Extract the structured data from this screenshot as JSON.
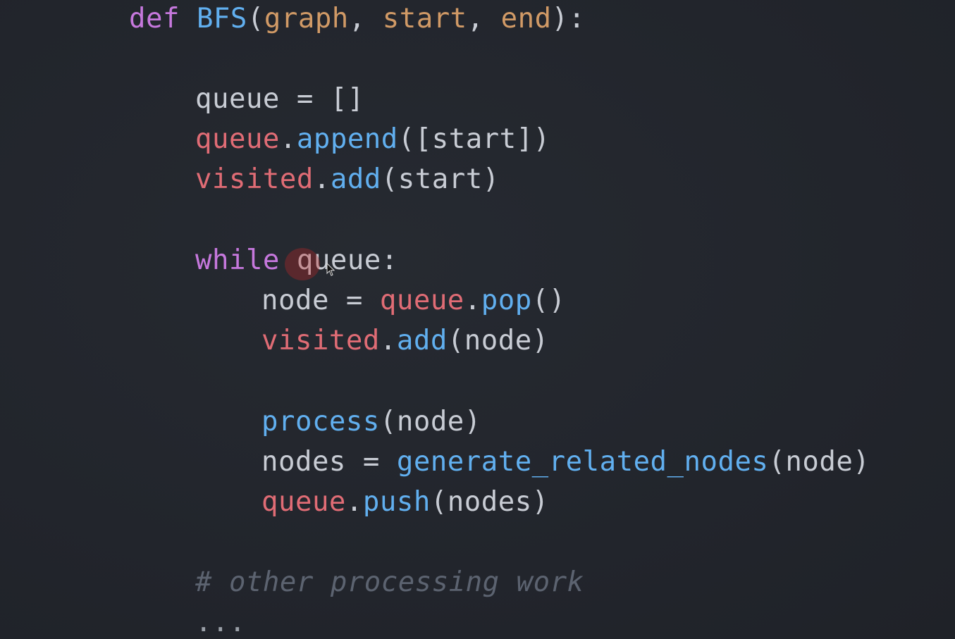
{
  "code": {
    "lines": [
      {
        "indent": 0,
        "tokens": [
          {
            "t": "def",
            "c": "kw"
          },
          {
            "t": " ",
            "c": "plain"
          },
          {
            "t": "BFS",
            "c": "fn"
          },
          {
            "t": "(",
            "c": "plain"
          },
          {
            "t": "graph",
            "c": "param"
          },
          {
            "t": ", ",
            "c": "plain"
          },
          {
            "t": "start",
            "c": "param"
          },
          {
            "t": ", ",
            "c": "plain"
          },
          {
            "t": "end",
            "c": "param"
          },
          {
            "t": "):",
            "c": "plain"
          }
        ]
      },
      {
        "indent": 1,
        "tokens": [
          {
            "t": "queue = []",
            "c": "plain"
          }
        ]
      },
      {
        "indent": 1,
        "tokens": [
          {
            "t": "queue",
            "c": "var"
          },
          {
            "t": ".",
            "c": "plain"
          },
          {
            "t": "append",
            "c": "fn"
          },
          {
            "t": "([start])",
            "c": "plain"
          }
        ]
      },
      {
        "indent": 1,
        "tokens": [
          {
            "t": "visited",
            "c": "var"
          },
          {
            "t": ".",
            "c": "plain"
          },
          {
            "t": "add",
            "c": "fn"
          },
          {
            "t": "(start)",
            "c": "plain"
          }
        ]
      },
      {
        "indent": 1,
        "tokens": [
          {
            "t": "while",
            "c": "kw"
          },
          {
            "t": " queue:",
            "c": "plain"
          }
        ]
      },
      {
        "indent": 2,
        "tokens": [
          {
            "t": "node = ",
            "c": "plain"
          },
          {
            "t": "queue",
            "c": "var"
          },
          {
            "t": ".",
            "c": "plain"
          },
          {
            "t": "pop",
            "c": "fn"
          },
          {
            "t": "()",
            "c": "plain"
          }
        ]
      },
      {
        "indent": 2,
        "tokens": [
          {
            "t": "visited",
            "c": "var"
          },
          {
            "t": ".",
            "c": "plain"
          },
          {
            "t": "add",
            "c": "fn"
          },
          {
            "t": "(node)",
            "c": "plain"
          }
        ]
      },
      {
        "indent": 2,
        "tokens": [
          {
            "t": "process",
            "c": "fn"
          },
          {
            "t": "(node)",
            "c": "plain"
          }
        ]
      },
      {
        "indent": 2,
        "tokens": [
          {
            "t": "nodes = ",
            "c": "plain"
          },
          {
            "t": "generate_related_nodes",
            "c": "fn"
          },
          {
            "t": "(node)",
            "c": "plain"
          }
        ]
      },
      {
        "indent": 2,
        "tokens": [
          {
            "t": "queue",
            "c": "var"
          },
          {
            "t": ".",
            "c": "plain"
          },
          {
            "t": "push",
            "c": "fn"
          },
          {
            "t": "(nodes)",
            "c": "plain"
          }
        ]
      },
      {
        "indent": 1,
        "tokens": [
          {
            "t": "# other processing work",
            "c": "comment"
          }
        ]
      },
      {
        "indent": 1,
        "tokens": [
          {
            "t": "...",
            "c": "dots"
          }
        ]
      }
    ]
  },
  "colors": {
    "background": "#22252c",
    "keyword": "#c678dd",
    "function": "#61afef",
    "parameter": "#d19a66",
    "variable": "#e06c75",
    "text": "#c8ccd4",
    "comment": "#5c6370"
  },
  "icons": {
    "pointer": "mouse-pointer-icon",
    "click_highlight": "click-highlight-icon"
  }
}
